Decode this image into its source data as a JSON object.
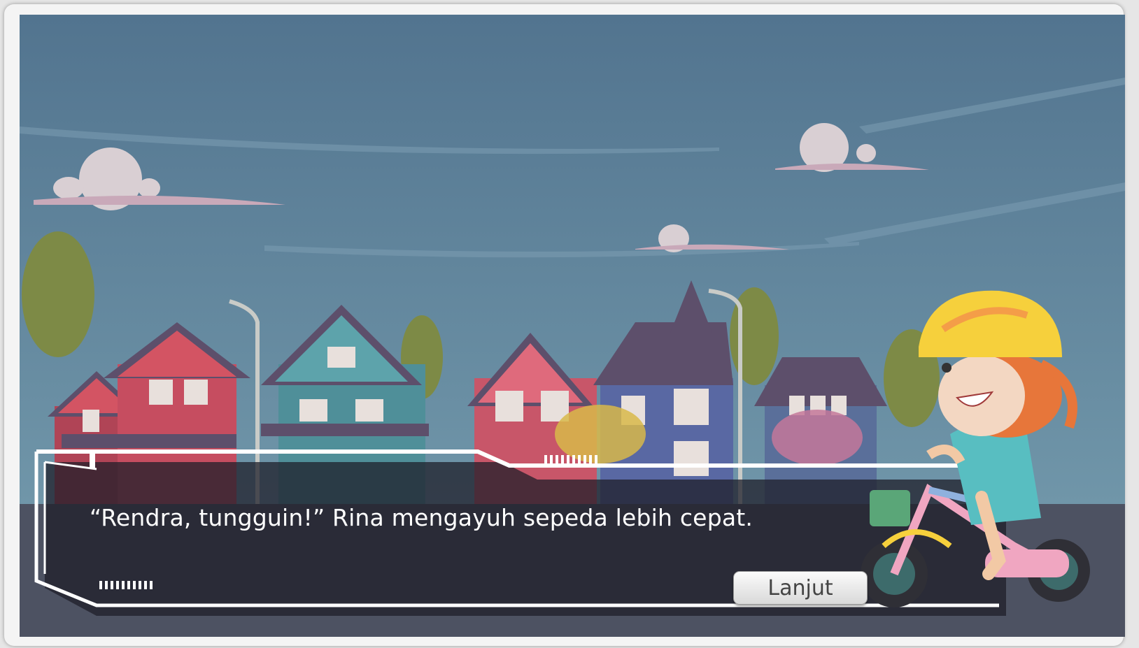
{
  "dialog": {
    "text": "“Rendra, tungguin!” Rina mengayuh sepeda lebih cepat.",
    "next_label": "Lanjut"
  },
  "colors": {
    "sky_top": "#52748f",
    "sky_bottom": "#6f9bae",
    "dialog_overlay": "#1e1e28",
    "dialog_border": "#ffffff",
    "button_text": "#444444",
    "helmet": "#f6d03c"
  },
  "icons": {
    "character": "girl-on-bicycle",
    "background": "suburban-street-houses"
  }
}
